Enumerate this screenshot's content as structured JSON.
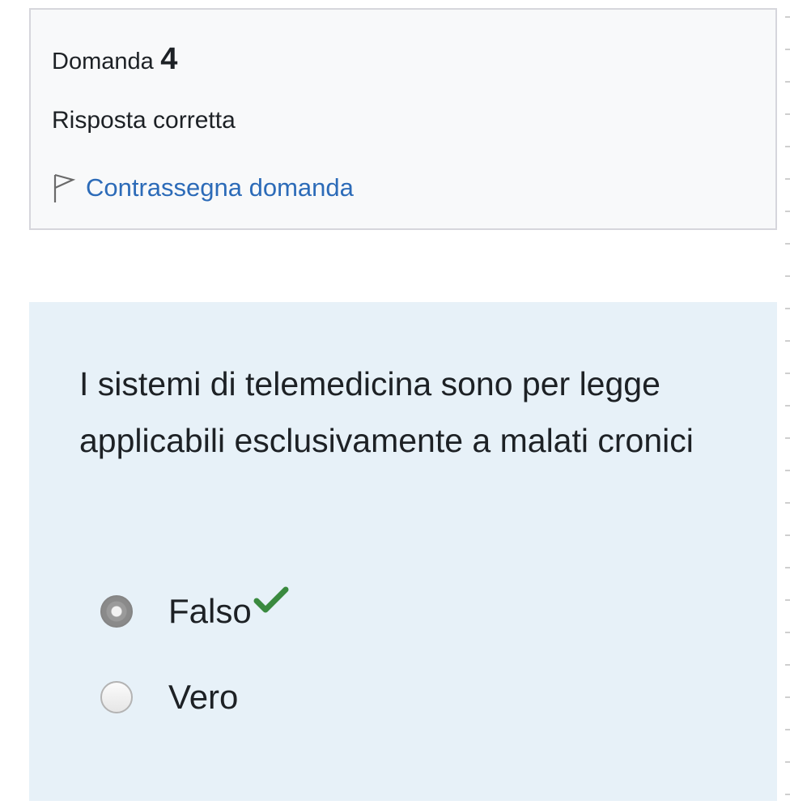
{
  "info": {
    "question_label": "Domanda",
    "question_number": "4",
    "state": "Risposta corretta",
    "flag_label": "Contrassegna domanda"
  },
  "question": {
    "text": "I sistemi di telemedicina sono per legge applicabili esclusivamente a malati cronici",
    "answers": [
      {
        "label": "Falso",
        "selected": true,
        "correct": true
      },
      {
        "label": "Vero",
        "selected": false,
        "correct": false
      }
    ]
  },
  "colors": {
    "link": "#2c6bb8",
    "correct_check": "#3a8a3f",
    "content_background": "#e7f1f8"
  },
  "icons": {
    "flag": "flag-icon",
    "check": "check-icon"
  }
}
